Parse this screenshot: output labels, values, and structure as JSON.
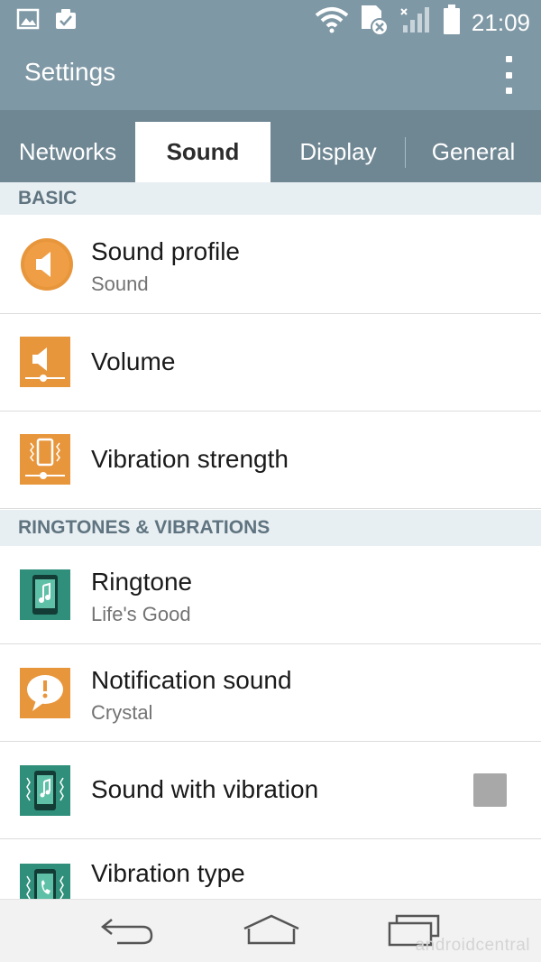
{
  "status_bar": {
    "time": "21:09",
    "icons": [
      "gallery-icon",
      "clipboard-check-icon",
      "wifi-icon",
      "sim-error-icon",
      "signal-icon",
      "battery-icon"
    ]
  },
  "app_bar": {
    "title": "Settings",
    "menu_icon": "overflow-menu-icon"
  },
  "tabs": [
    {
      "label": "Networks",
      "active": false
    },
    {
      "label": "Sound",
      "active": true
    },
    {
      "label": "Display",
      "active": false
    },
    {
      "label": "General",
      "active": false
    }
  ],
  "sections": [
    {
      "header": "BASIC",
      "items": [
        {
          "title": "Sound profile",
          "subtitle": "Sound",
          "icon": "speaker-circle-icon"
        },
        {
          "title": "Volume",
          "subtitle": "",
          "icon": "volume-icon"
        },
        {
          "title": "Vibration strength",
          "subtitle": "",
          "icon": "vibration-strength-icon"
        }
      ]
    },
    {
      "header": "RINGTONES & VIBRATIONS",
      "items": [
        {
          "title": "Ringtone",
          "subtitle": "Life's Good",
          "icon": "ringtone-icon"
        },
        {
          "title": "Notification sound",
          "subtitle": "Crystal",
          "icon": "notification-bubble-icon"
        },
        {
          "title": "Sound with vibration",
          "subtitle": "",
          "icon": "sound-vibration-icon",
          "checkbox": false
        },
        {
          "title": "Vibration type",
          "subtitle": "",
          "icon": "vibration-type-icon"
        }
      ]
    }
  ],
  "nav_bar": {
    "buttons": [
      "back-icon",
      "home-icon",
      "recents-icon"
    ],
    "watermark": "androidcentral"
  },
  "colors": {
    "header": "#7f98a5",
    "tab_bar": "#6f8793",
    "orange": "#e8963c",
    "teal": "#2f8f7a",
    "section_bg": "#e8eff2"
  }
}
